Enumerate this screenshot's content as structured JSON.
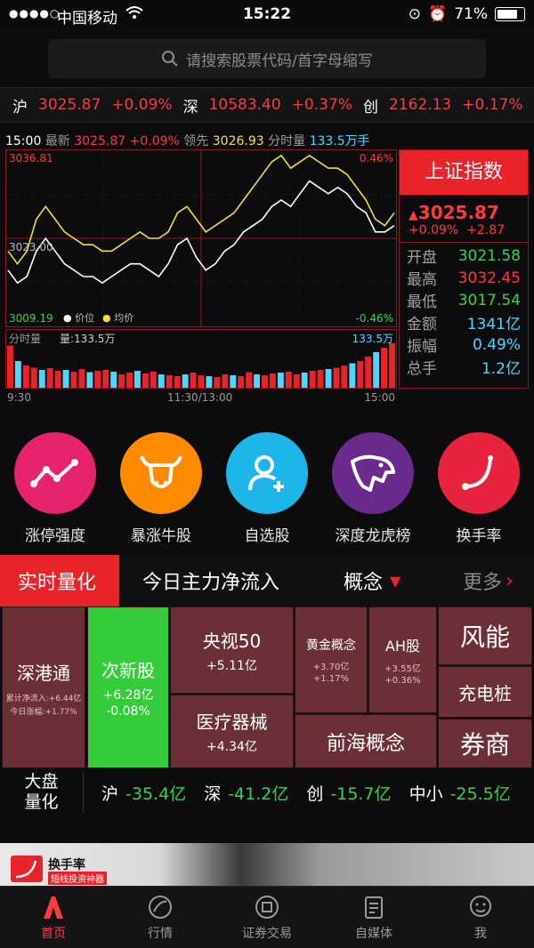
{
  "status": {
    "carrier": "中国移动",
    "time": "15:22",
    "battery": "71%"
  },
  "search": {
    "placeholder": "请搜索股票代码/首字母缩写"
  },
  "ticker": [
    {
      "label": "沪",
      "value": "3025.87",
      "change": "+0.09%"
    },
    {
      "label": "深",
      "value": "10583.40",
      "change": "+0.37%"
    },
    {
      "label": "创",
      "value": "2162.13",
      "change": "+0.17%"
    }
  ],
  "chart_header": {
    "time": "15:00",
    "latest_label": "最新",
    "latest": "3025.87",
    "latest_change": "+0.09%",
    "lead_label": "领先",
    "lead": "3026.93",
    "vol_label": "分时量",
    "vol": "133.5万手"
  },
  "chart_labels": {
    "high": "3036.81",
    "high_pct": "0.46%",
    "mid": "3023.00",
    "low": "3009.19",
    "low_pct": "-0.46%",
    "legend_price": "价位",
    "legend_avg": "均价",
    "vol_title": "分时量",
    "vol_value": "量:133.5万",
    "vol_max": "133.5万",
    "t_open": "9:30",
    "t_mid": "11:30/13:00",
    "t_close": "15:00"
  },
  "chart_data": {
    "type": "line",
    "ylim": [
      3009.19,
      3036.81
    ],
    "series": [
      {
        "name": "价位",
        "color": "#ffffff",
        "values": [
          3018,
          3016,
          3017,
          3021,
          3023,
          3021,
          3019,
          3018,
          3017,
          3017,
          3016,
          3017,
          3018,
          3019,
          3019,
          3018,
          3017,
          3019,
          3022,
          3023,
          3020,
          3018,
          3019,
          3021,
          3022,
          3024,
          3025,
          3026,
          3028,
          3029,
          3028,
          3030,
          3032,
          3031,
          3030,
          3031,
          3030,
          3028,
          3027,
          3024,
          3024,
          3025
        ]
      },
      {
        "name": "均价",
        "color": "#f0e040",
        "values": [
          3021,
          3019,
          3021,
          3026,
          3028,
          3026,
          3024,
          3023,
          3022,
          3022,
          3021,
          3021,
          3022,
          3023,
          3024,
          3023,
          3023,
          3024,
          3027,
          3028,
          3026,
          3024,
          3025,
          3026,
          3027,
          3029,
          3031,
          3033,
          3035,
          3036,
          3034,
          3035,
          3036,
          3035,
          3034,
          3034,
          3033,
          3031,
          3029,
          3026,
          3025,
          3027
        ]
      }
    ],
    "volume": [
      95,
      60,
      50,
      45,
      40,
      44,
      38,
      40,
      36,
      42,
      35,
      38,
      40,
      36,
      30,
      34,
      38,
      32,
      36,
      30,
      28,
      26,
      30,
      34,
      28,
      26,
      24,
      30,
      28,
      26,
      35,
      30,
      28,
      32,
      34,
      36,
      30,
      34,
      38,
      40,
      42,
      45,
      50,
      55,
      60,
      70,
      80,
      90,
      100
    ]
  },
  "quote_panel": {
    "name": "上证指数",
    "price": "3025.87",
    "pct": "+0.09%",
    "chg": "+2.87",
    "rows": [
      {
        "k": "开盘",
        "v": "3021.58",
        "c": "green"
      },
      {
        "k": "最高",
        "v": "3032.45",
        "c": "red"
      },
      {
        "k": "最低",
        "v": "3017.54",
        "c": "green"
      },
      {
        "k": "金额",
        "v": "1341亿",
        "c": "cyan"
      },
      {
        "k": "振幅",
        "v": "0.49%",
        "c": "cyan"
      },
      {
        "k": "总手",
        "v": "1.2亿",
        "c": "cyan"
      }
    ]
  },
  "shortcuts": [
    {
      "label": "涨停强度",
      "color": "#e8236d",
      "icon": "trend-line-icon"
    },
    {
      "label": "暴涨牛股",
      "color": "#ff8a00",
      "icon": "bull-icon"
    },
    {
      "label": "自选股",
      "color": "#1cb6ea",
      "icon": "user-add-icon"
    },
    {
      "label": "深度龙虎榜",
      "color": "#6a2a8e",
      "icon": "tiger-icon"
    },
    {
      "label": "换手率",
      "color": "#e8233e",
      "icon": "curve-icon"
    }
  ],
  "tabs": {
    "realtime": "实时量化",
    "main_flow": "今日主力净流入",
    "concept": "概念",
    "more": "更多"
  },
  "tiles": [
    {
      "name": "深港通",
      "line1": "累计净流入:+6.44亿",
      "line2": "今日涨幅:+1.77%"
    },
    {
      "name": "次新股",
      "v1": "+6.28亿",
      "v2": "-0.08%"
    },
    {
      "name": "央视50",
      "v1": "+5.11亿"
    },
    {
      "name": "黄金概念",
      "v1": "+3.70亿",
      "v2": "+1.17%"
    },
    {
      "name": "AH股",
      "v1": "+3.55亿",
      "v2": "+0.36%"
    },
    {
      "name": "风能"
    },
    {
      "name": "医疗器械",
      "v1": "+4.34亿"
    },
    {
      "name": "充电桩"
    },
    {
      "name": "前海概念"
    },
    {
      "name": "券商"
    }
  ],
  "flow": {
    "title1": "大盘",
    "title2": "量化",
    "items": [
      {
        "k": "沪",
        "v": "-35.4亿"
      },
      {
        "k": "深",
        "v": "-41.2亿"
      },
      {
        "k": "创",
        "v": "-15.7亿"
      },
      {
        "k": "中小",
        "v": "-25.5亿"
      }
    ]
  },
  "banner": {
    "title": "换手率",
    "subtitle": "短线投资神器"
  },
  "nav": [
    {
      "label": "首页",
      "icon": "home-a-icon",
      "active": true
    },
    {
      "label": "行情",
      "icon": "market-icon",
      "active": false
    },
    {
      "label": "证券交易",
      "icon": "trade-icon",
      "active": false
    },
    {
      "label": "自媒体",
      "icon": "media-icon",
      "active": false
    },
    {
      "label": "我",
      "icon": "me-icon",
      "active": false
    }
  ]
}
